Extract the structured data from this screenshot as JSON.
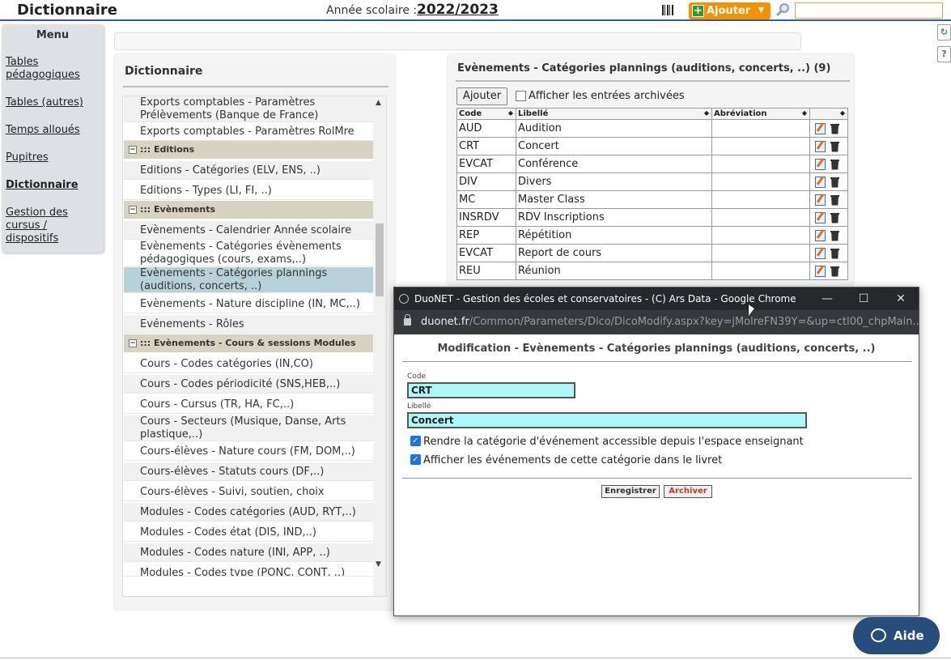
{
  "app": {
    "title": "Dictionnaire",
    "year_label": "Année scolaire :",
    "year_value": "2022/2023"
  },
  "toolbar": {
    "add_label": "Ajouter",
    "search_placeholder": ""
  },
  "menu": {
    "title": "Menu",
    "items": [
      {
        "label": "Tables pédagogiques"
      },
      {
        "label": "Tables (autres)"
      },
      {
        "label": "Temps alloués"
      },
      {
        "label": "Pupitres"
      },
      {
        "label": "Dictionnaire"
      },
      {
        "label": "Gestion des cursus / dispositifs"
      }
    ]
  },
  "dictionary": {
    "title": "Dictionnaire",
    "items": [
      {
        "label": "Exports comptables - Paramètres Prélèvements (Banque de France)"
      },
      {
        "label": "Exports comptables - Paramètres RolMre"
      },
      {
        "label": "::: Editions"
      },
      {
        "label": "Editions - Catégories (ELV, ENS, ..)"
      },
      {
        "label": "Editions - Types (LI, FI, ..)"
      },
      {
        "label": "::: Evènements"
      },
      {
        "label": "Evènements - Calendrier Année scolaire"
      },
      {
        "label": "Evènements - Catégories évènements pédagogiques (cours, exams,..)"
      },
      {
        "label": "Evènements - Catégories plannings (auditions, concerts, ..)"
      },
      {
        "label": "Evènements - Nature discipline (IN, MC,..)"
      },
      {
        "label": "Evénements - Rôles"
      },
      {
        "label": "::: Evènements - Cours & sessions Modules"
      },
      {
        "label": "Cours - Codes catégories (IN,CO)"
      },
      {
        "label": "Cours - Codes périodicité (SNS,HEB,..)"
      },
      {
        "label": "Cours - Cursus (TR, HA, FC,..)"
      },
      {
        "label": "Cours - Secteurs (Musique, Danse, Arts plastique,..)"
      },
      {
        "label": "Cours-élèves - Nature cours (FM, DOM,..)"
      },
      {
        "label": "Cours-élèves - Statuts cours (DF,..)"
      },
      {
        "label": "Cours-élèves - Suivi, soutien, choix"
      },
      {
        "label": "Modules - Codes catégories (AUD, RYT,..)"
      },
      {
        "label": "Modules - Codes état (DIS, IND,..)"
      },
      {
        "label": "Modules - Codes nature (INI, APP, ..)"
      },
      {
        "label": "Modules - Codes type (PONC, CONT, ..)"
      }
    ]
  },
  "events": {
    "title": "Evènements - Catégories plannings (auditions, concerts, ..) (9)",
    "add_label": "Ajouter",
    "archive_label": "Afficher les entrées archivées",
    "columns": [
      "Code",
      "Libellé",
      "Abréviation"
    ],
    "rows": [
      {
        "code": "AUD",
        "label": "Audition",
        "abbr": ""
      },
      {
        "code": "CRT",
        "label": "Concert",
        "abbr": ""
      },
      {
        "code": "EVCAT",
        "label": "Conférence",
        "abbr": ""
      },
      {
        "code": "DIV",
        "label": "Divers",
        "abbr": ""
      },
      {
        "code": "MC",
        "label": "Master Class",
        "abbr": ""
      },
      {
        "code": "INSRDV",
        "label": "RDV Inscriptions",
        "abbr": ""
      },
      {
        "code": "REP",
        "label": "Répétition",
        "abbr": ""
      },
      {
        "code": "EVCAT",
        "label": "Report de cours",
        "abbr": ""
      },
      {
        "code": "REU",
        "label": "Réunion",
        "abbr": ""
      }
    ]
  },
  "popup": {
    "window_title": "DuoNET - Gestion des écoles et conservatoires - (C) Ars Data - Google Chrome",
    "url_host": "duonet.fr",
    "url_path": "/Common/Parameters/Dico/DicoModify.aspx?key=jMolreFN39Y=&up=ctl00_chpMain...",
    "title": "Modification - Evènements - Catégories plannings (auditions, concerts, ..)",
    "code_label": "Code",
    "code_value": "CRT",
    "libelle_label": "Libellé",
    "libelle_value": "Concert",
    "check1": "Rendre la catégorie d'événement accessible depuis l'espace enseignant",
    "check2": "Afficher les événements de cette catégorie dans le livret",
    "save_label": "Enregistrer",
    "archive_label": "Archiver"
  },
  "help": {
    "label": "Aide"
  }
}
